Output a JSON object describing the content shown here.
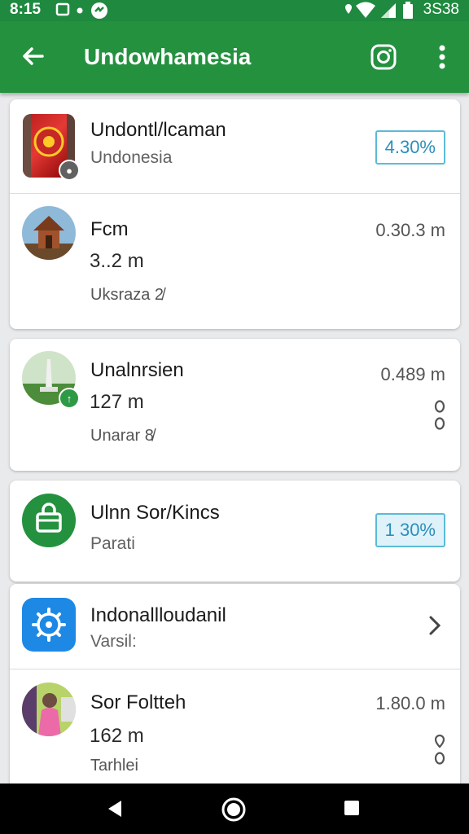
{
  "status_bar": {
    "time": "8:15",
    "right_time": "3S38"
  },
  "app_bar": {
    "title": "Undowhamesia"
  },
  "cards": [
    {
      "items": [
        {
          "name": "Undontl/lcaman",
          "sub": "Undonesia",
          "pill": "4.30%"
        },
        {
          "name": "Fcm",
          "distance": "3..2 m",
          "tag": "Uksraza 2̸",
          "value": "0.30.3 m"
        }
      ]
    },
    {
      "items": [
        {
          "name": "Unalnrsien",
          "distance": "127 m",
          "tag": "Unarar 8̸",
          "value": "0.489 m"
        }
      ]
    },
    {
      "items": [
        {
          "name": "Ulnn Sor/Kincs",
          "sub": "Parati",
          "pill": "1 30%"
        }
      ]
    },
    {
      "items": [
        {
          "name": "Indonallloudanil",
          "sub": "Varsil:"
        },
        {
          "name": "Sor Foltteh",
          "distance": "162 m",
          "tag": "Tarhlei",
          "value": "1.80.0 m"
        }
      ]
    }
  ]
}
